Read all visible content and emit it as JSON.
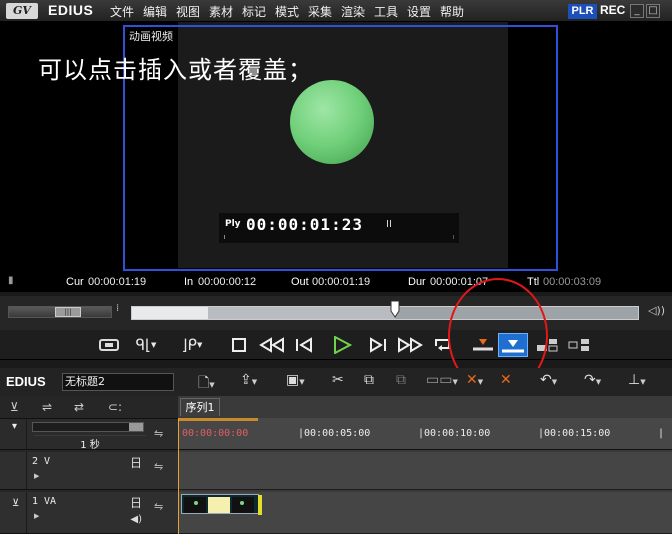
{
  "menubar": {
    "logo": "GV",
    "title": "EDIUS",
    "items": [
      "文件",
      "编辑",
      "视图",
      "素材",
      "标记",
      "模式",
      "采集",
      "渲染",
      "工具",
      "设置",
      "帮助"
    ],
    "plr": "PLR",
    "rec": "REC",
    "window_buttons": [
      "_",
      "□",
      "×"
    ]
  },
  "preview": {
    "frame_label": "动画视频",
    "caption": "可以点击插入或者覆盖；",
    "ply_label": "Ply",
    "ply_timecode": "00:00:01:23",
    "ply_pause": "II",
    "cur_label": "Cur",
    "cur_value": "00:00:01:19",
    "in_label": "In",
    "in_value": "00:00:00:12",
    "out_label": "Out",
    "out_value": "00:00:01:19",
    "dur_label": "Dur",
    "dur_value": "00:00:01:07",
    "ttl_label": "Ttl",
    "ttl_value": "00:00:03:09"
  },
  "scrub": {
    "in_fraction": 0.15,
    "out_fraction": 0.52,
    "playhead_fraction": 0.52
  },
  "transport": {
    "buttons": [
      "mode-icon",
      "set-in-icon",
      "set-out-icon",
      "stop-icon",
      "rewind-icon",
      "step-back-icon",
      "play-icon",
      "step-forward-icon",
      "fast-forward-icon",
      "loop-icon",
      "insert-icon",
      "overwrite-icon",
      "trim-icon",
      "sync-icon"
    ]
  },
  "timeline": {
    "logo": "EDIUS",
    "project_name": "无标题2",
    "sequence_tab": "序列1",
    "zoom_label": "1 秒",
    "ruler_labels": [
      "00:00:00:00",
      "|00:00:05:00",
      "|00:00:10:00",
      "|00:00:15:00",
      "|"
    ],
    "tracks": [
      {
        "name": "2 V",
        "type": "日"
      },
      {
        "name": "1 VA",
        "type": "日"
      }
    ]
  },
  "colors": {
    "accent_blue": "#1f6fd0",
    "frame_border": "#3050d8",
    "highlight_red": "#e01818",
    "playhead_orange": "#e8a030"
  }
}
